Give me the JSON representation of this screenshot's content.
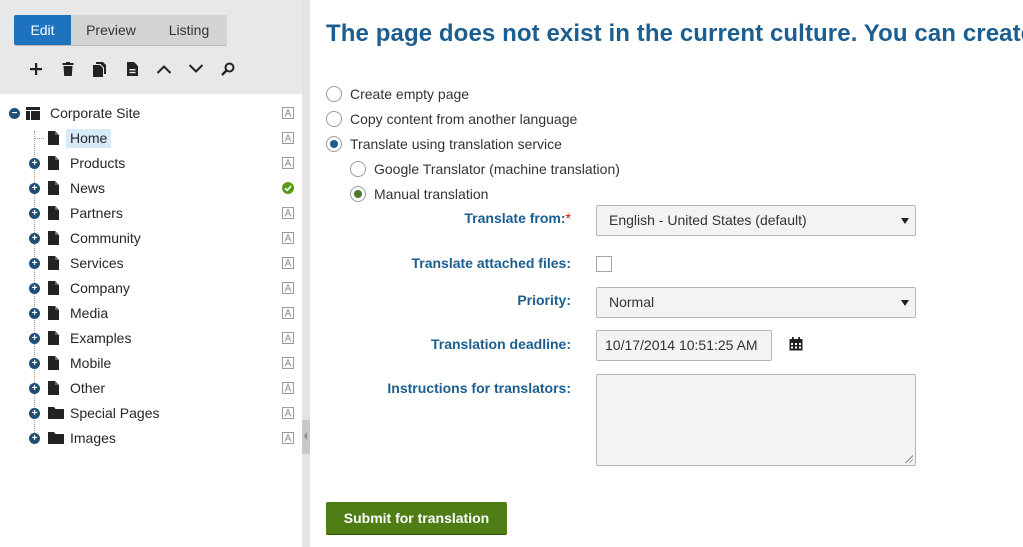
{
  "tabs": [
    {
      "label": "Edit",
      "active": true
    },
    {
      "label": "Preview",
      "active": false
    },
    {
      "label": "Listing",
      "active": false
    }
  ],
  "toolbar": [
    "plus-icon",
    "delete-icon",
    "copy-icon",
    "page-icon",
    "chevron-up-icon",
    "chevron-down-icon",
    "search-icon"
  ],
  "tree": {
    "root": "Corporate Site",
    "items": [
      {
        "label": "Home",
        "selected": true,
        "expandable": false,
        "icon": "page-icon",
        "status": "not-translated-icon"
      },
      {
        "label": "Products",
        "expandable": true,
        "icon": "page-icon",
        "status": "not-translated-icon"
      },
      {
        "label": "News",
        "expandable": true,
        "icon": "page-icon",
        "status": "published-check-icon"
      },
      {
        "label": "Partners",
        "expandable": true,
        "icon": "page-icon",
        "status": "not-translated-icon"
      },
      {
        "label": "Community",
        "expandable": true,
        "icon": "page-icon",
        "status": "not-translated-icon"
      },
      {
        "label": "Services",
        "expandable": true,
        "icon": "page-icon",
        "status": "not-translated-icon"
      },
      {
        "label": "Company",
        "expandable": true,
        "icon": "page-icon",
        "status": "not-translated-icon"
      },
      {
        "label": "Media",
        "expandable": true,
        "icon": "page-icon",
        "status": "not-translated-icon"
      },
      {
        "label": "Examples",
        "expandable": true,
        "icon": "page-icon",
        "status": "not-translated-icon"
      },
      {
        "label": "Mobile",
        "expandable": true,
        "icon": "page-icon",
        "status": "not-translated-icon"
      },
      {
        "label": "Other",
        "expandable": true,
        "icon": "page-icon",
        "status": "not-translated-icon"
      },
      {
        "label": "Special Pages",
        "expandable": true,
        "icon": "folder-icon",
        "status": "not-translated-icon"
      },
      {
        "label": "Images",
        "expandable": true,
        "icon": "folder-icon",
        "status": "not-translated-icon"
      }
    ]
  },
  "main": {
    "title": "The page does not exist in the current culture. You can create",
    "options": [
      {
        "label": "Create empty page",
        "checked": false
      },
      {
        "label": "Copy content from another language",
        "checked": false
      },
      {
        "label": "Translate using translation service",
        "checked": true
      }
    ],
    "sub_options": [
      {
        "label": "Google Translator (machine translation)",
        "checked": false
      },
      {
        "label": "Manual translation",
        "checked": true
      }
    ],
    "form": {
      "translate_from_label": "Translate from:",
      "required_mark": "*",
      "translate_from_value": "English - United States (default)",
      "attached_files_label": "Translate attached files:",
      "attached_files_checked": false,
      "priority_label": "Priority:",
      "priority_value": "Normal",
      "deadline_label": "Translation deadline:",
      "deadline_value": "10/17/2014 10:51:25 AM",
      "instructions_label": "Instructions for translators:",
      "instructions_value": ""
    },
    "submit_label": "Submit for translation"
  },
  "colors": {
    "accent": "#1e73be",
    "title": "#1b5e8f",
    "submit": "#4d7d14",
    "status_ok": "#5b9b1c"
  }
}
